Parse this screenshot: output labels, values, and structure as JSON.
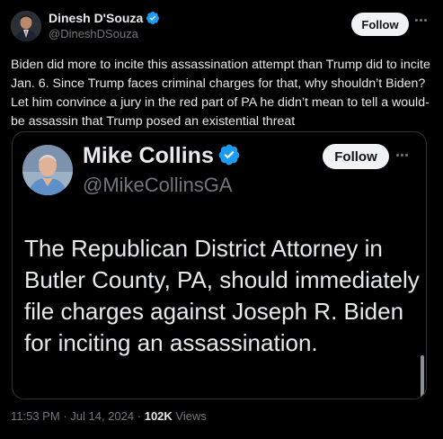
{
  "tweet": {
    "author_name": "Dinesh D'Souza",
    "author_handle": "@DineshDSouza",
    "follow_label": "Follow",
    "text": "Biden did more to incite this assassination attempt than Trump did to incite Jan. 6. Since Trump faces criminal charges for that, why shouldn’t Biden? Let him convince a jury in the red part of PA he didn’t mean to tell a would-be assassin that Trump posed an existential threat",
    "time": "11:53 PM",
    "date": "Jul 14, 2024",
    "views_count": "102K",
    "views_label": "Views",
    "separator": "·"
  },
  "quoted": {
    "author_name": "Mike Collins",
    "author_handle": "@MikeCollinsGA",
    "follow_label": "Follow",
    "text": "The Republican District Attorney in Butler County, PA, should immediately file charges against Joseph R. Biden for inciting an assassination."
  },
  "icons": {
    "verified": "verified-badge-icon",
    "more": "more-options-icon"
  },
  "colors": {
    "background": "#000000",
    "text": "#e7e9ea",
    "secondary": "#71767b",
    "verified": "#1d9bf0",
    "follow_bg": "#eff3f4"
  }
}
